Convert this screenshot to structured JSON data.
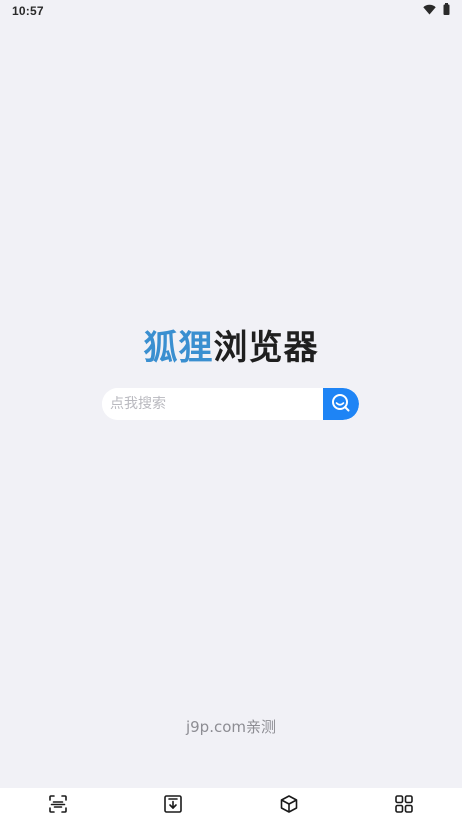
{
  "status_bar": {
    "time": "10:57",
    "icons": [
      "wifi-icon",
      "battery-icon"
    ]
  },
  "logo": {
    "accent_text": "狐狸",
    "main_text": "浏览器",
    "accent_color": "#3a8fd0"
  },
  "search": {
    "placeholder": "点我搜索",
    "value": "",
    "button_color": "#1e84f5",
    "button_icon": "search-icon"
  },
  "watermark": "j9p.com亲测",
  "bottom_nav": {
    "items": [
      {
        "icon": "scan-icon"
      },
      {
        "icon": "download-icon"
      },
      {
        "icon": "cube-icon"
      },
      {
        "icon": "grid-icon"
      }
    ]
  }
}
